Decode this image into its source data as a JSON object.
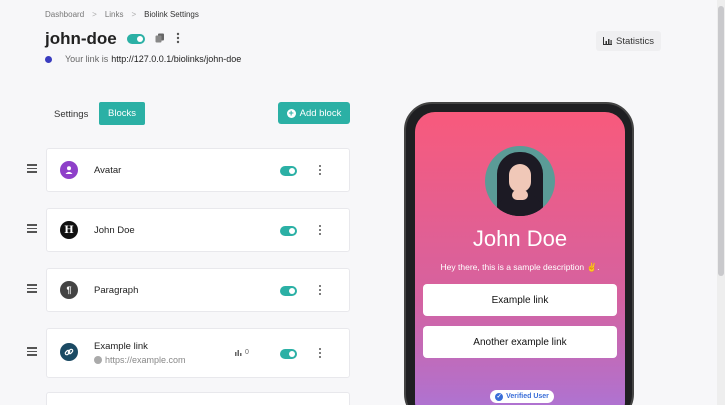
{
  "breadcrumb": {
    "items": [
      "Dashboard",
      "Links",
      "Biolink Settings"
    ],
    "separator": ">"
  },
  "header": {
    "title": "john-doe",
    "statistics_label": "Statistics",
    "link_prefix": "Your link is",
    "link_url": "http://127.0.0.1/biolinks/john-doe"
  },
  "tabs": {
    "settings": "Settings",
    "blocks": "Blocks"
  },
  "add_block_label": "Add block",
  "blocks": [
    {
      "title": "Avatar",
      "icon": "user-icon",
      "color": "#8e3fc9",
      "glyph": "●",
      "enabled": true
    },
    {
      "title": "John Doe",
      "icon": "heading-icon",
      "color": "#111111",
      "glyph": "H",
      "enabled": true
    },
    {
      "title": "Paragraph",
      "icon": "paragraph-icon",
      "color": "#444444",
      "glyph": "¶",
      "enabled": true
    },
    {
      "title": "Example link",
      "icon": "link-icon",
      "color": "#1b4a63",
      "glyph": "⛓",
      "subtitle": "https://example.com",
      "clicks": "0",
      "enabled": true
    }
  ],
  "preview": {
    "name": "John Doe",
    "description": "Hey there, this is a sample description ✌️.",
    "links": [
      "Example link",
      "Another example link"
    ],
    "verified": "Verified User"
  },
  "colors": {
    "accent": "#2bb0a5",
    "gradient_top": "#f85a7c",
    "gradient_bottom": "#a975d8"
  }
}
